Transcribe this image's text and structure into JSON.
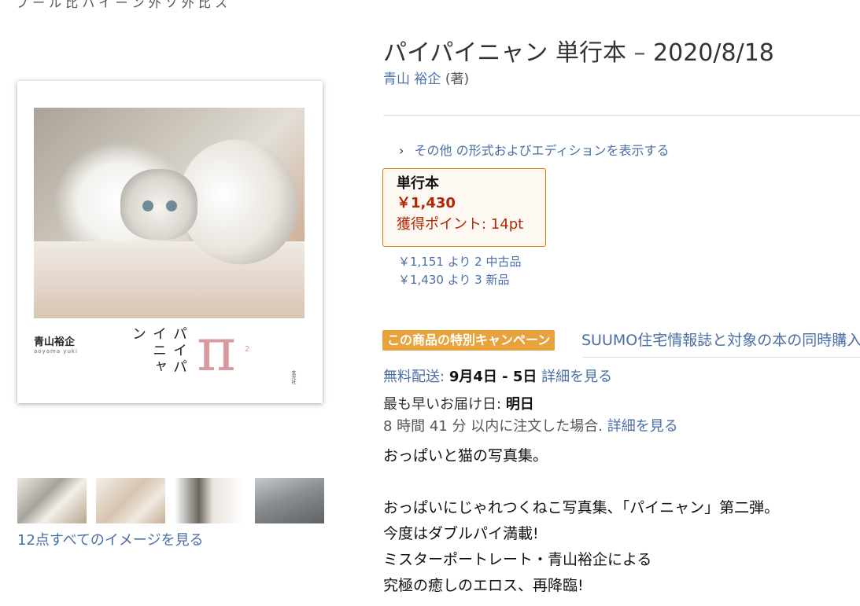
{
  "top_fragment": "ブ ー ル 比 ハ イ ー ン 外 ソ 外 比 ス",
  "cover": {
    "author_jp": "青山裕企",
    "author_roman": "aoyama yuki",
    "title_vertical": "パイパイニャン",
    "pi_symbol": "π",
    "pi_sup": "2",
    "publisher": "玄光社"
  },
  "gallery": {
    "see_all_link": "12点すべてのイメージを見る"
  },
  "product": {
    "title": "パイパイニャン",
    "format": "単行本",
    "separator": "–",
    "date": "2020/8/18",
    "author": "青山 裕企",
    "author_role": "(著)"
  },
  "formats_link": {
    "chevron": "›",
    "text": "その他 の形式およびエディションを表示する"
  },
  "format_box": {
    "name": "単行本",
    "price": "￥1,430",
    "points": "獲得ポイント: 14pt"
  },
  "offers": [
    "￥1,151 より 2 中古品",
    "￥1,430 より 3 新品"
  ],
  "campaign": {
    "badge": "この商品の特別キャンペーン",
    "text": "SUUMO住宅情報誌と対象の本の同時購入"
  },
  "shipping": {
    "label": "無料配送:",
    "dates": "9月4日 - 5日",
    "details_link": "詳細を見る"
  },
  "earliest": {
    "label": "最も早いお届け日:",
    "value": "明日"
  },
  "cutoff": {
    "text": "8 時間 41 分 以内に注文した場合.",
    "details_link": "詳細を見る"
  },
  "description": {
    "line1": "おっぱいと猫の写真集。",
    "line2": "おっぱいにじゃれつくねこ写真集、「パイニャン」第二弾。",
    "line3": "今度はダブルパイ満載!",
    "line4": "ミスターポートレート・青山裕企による",
    "line5": "究極の癒しのエロス、再降臨!"
  },
  "colors": {
    "link": "#4a6fa5",
    "price": "#b12704",
    "selected_border": "#e77600",
    "badge": "#e8a33d"
  }
}
